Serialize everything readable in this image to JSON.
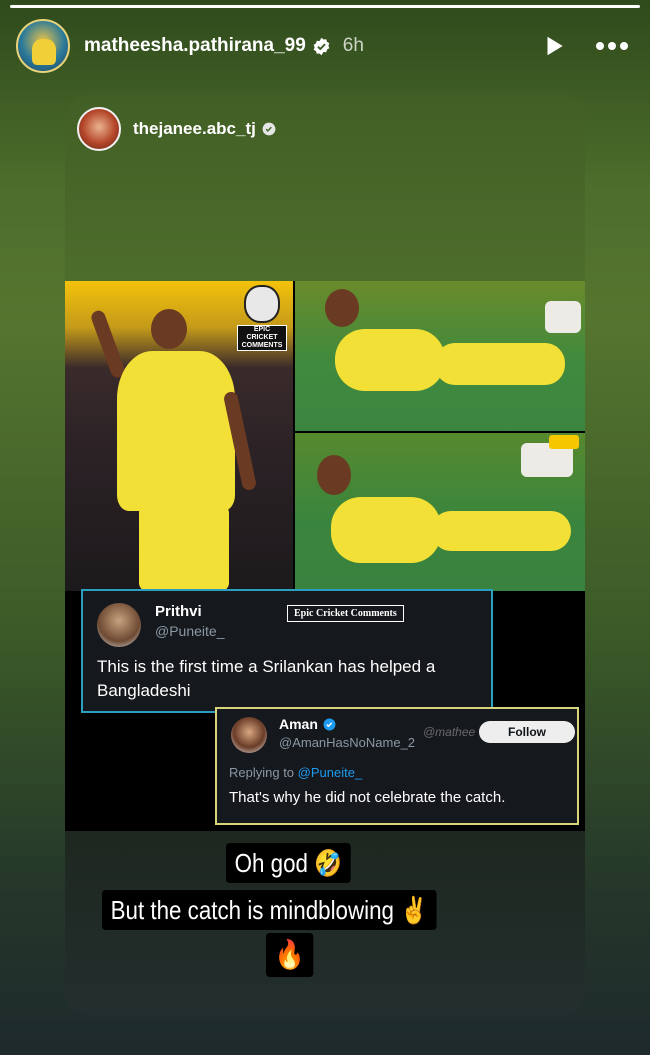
{
  "story": {
    "progress": 1.0,
    "username": "matheesha.pathirana_99",
    "time": "6h",
    "icons": {
      "verified": "verified-badge-icon",
      "play": "play-icon",
      "more": "more-options-icon"
    }
  },
  "reshare": {
    "username": "thejanee.abc_tj",
    "verified_icon": "verified-badge-icon"
  },
  "collage": {
    "meme_badge_text": "EPIC CRICKET COMMENTS"
  },
  "tweet1": {
    "name": "Prithvi",
    "handle": "@Puneite_",
    "tag": "Epic Cricket Comments",
    "text": "This is the first time a Srilankan has helped a Bangladeshi"
  },
  "tweet2": {
    "name": "Aman",
    "handle": "@AmanHasNoName_2",
    "watermark": "@mathee",
    "follow_label": "Follow",
    "reply_prefix": "Replying to",
    "reply_to": "@Puneite_",
    "text": "That's why he did not celebrate the catch."
  },
  "captions": {
    "line1": "Oh god 🤣",
    "line2": "But the catch is mindblowing ✌️",
    "line3": "🔥"
  },
  "colors": {
    "tweet1_border": "#2b9fbf",
    "tweet2_border": "#d7d37a",
    "link": "#1d9bf0",
    "verified": "#1d9bf0"
  }
}
